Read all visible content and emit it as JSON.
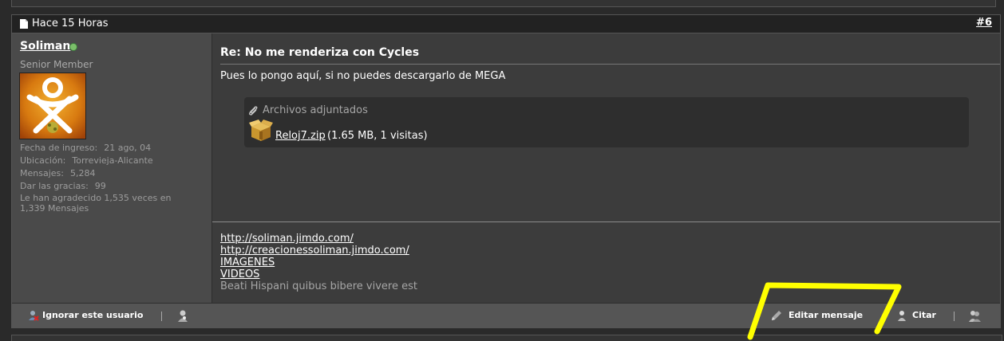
{
  "post": {
    "date": "Hace 15 Horas",
    "number": "#6",
    "title": "Re: No me renderiza con Cycles",
    "message": "Pues lo pongo aquí, si no puedes descargarlo de MEGA"
  },
  "user": {
    "name": "Soliman",
    "title": "Senior Member",
    "stats": [
      {
        "label": "Fecha de ingreso:",
        "value": "21 ago, 04"
      },
      {
        "label": "Ubicación:",
        "value": "Torrevieja-Alicante"
      },
      {
        "label": "Mensajes:",
        "value": "5,284"
      },
      {
        "label": "Dar las gracias:",
        "value": "99"
      }
    ],
    "thanks": "Le han agradecido 1,535 veces en 1,339 Mensajes"
  },
  "attachments": {
    "legend": "Archivos adjuntados",
    "file_name": "Reloj7.zip",
    "file_info": "(1.65 MB, 1 visitas)"
  },
  "signature": {
    "links": [
      "http://soliman.jimdo.com/",
      "http://creacionessoliman.jimdo.com/",
      "IMAGENES",
      "VIDEOS"
    ],
    "motto": "Beati Hispani quibus bibere vivere est"
  },
  "footer": {
    "ignore_label": "Ignorar este usuario",
    "edit_label": "Editar mensaje",
    "quote_label": "Citar"
  },
  "colors": {
    "annotation": "#ffff00",
    "online": "#7bbf6a"
  }
}
